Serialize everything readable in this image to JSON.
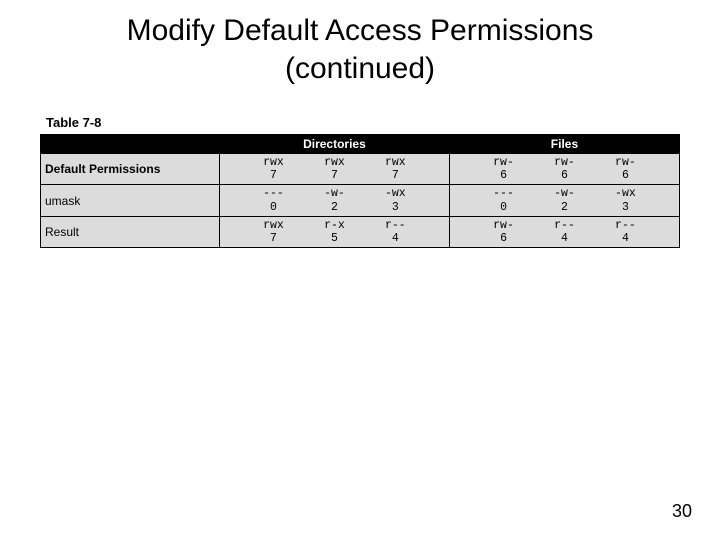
{
  "slide": {
    "title_line1": "Modify Default Access Permissions",
    "title_line2": "(continued)"
  },
  "page_number": "30",
  "table": {
    "label": "Table 7-8",
    "header_blank": "",
    "header_dir": "Directories",
    "header_files": "Files",
    "rows": [
      {
        "label": "Default Permissions",
        "dir": {
          "sym": [
            "rwx",
            "rwx",
            "rwx"
          ],
          "num": [
            "7",
            "7",
            "7"
          ]
        },
        "file": {
          "sym": [
            "rw-",
            "rw-",
            "rw-"
          ],
          "num": [
            "6",
            "6",
            "6"
          ]
        }
      },
      {
        "label": "umask",
        "dir": {
          "sym": [
            "---",
            "-w-",
            "-wx"
          ],
          "num": [
            "0",
            "2",
            "3"
          ]
        },
        "file": {
          "sym": [
            "---",
            "-w-",
            "-wx"
          ],
          "num": [
            "0",
            "2",
            "3"
          ]
        }
      },
      {
        "label": "Result",
        "dir": {
          "sym": [
            "rwx",
            "r-x",
            "r--"
          ],
          "num": [
            "7",
            "5",
            "4"
          ]
        },
        "file": {
          "sym": [
            "rw-",
            "r--",
            "r--"
          ],
          "num": [
            "6",
            "4",
            "4"
          ]
        }
      }
    ]
  }
}
